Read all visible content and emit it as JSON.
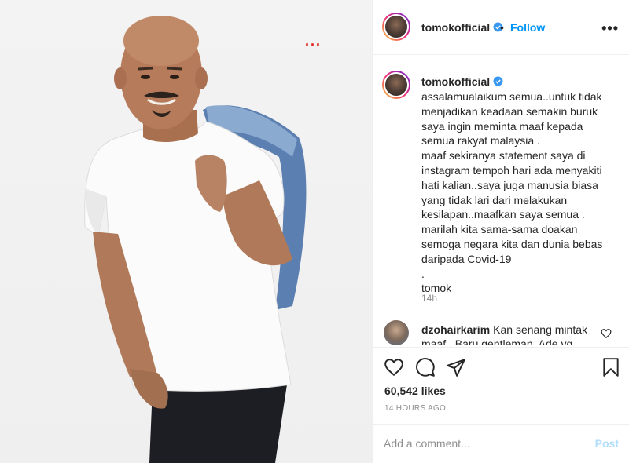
{
  "post": {
    "username": "tomokofficial",
    "follow_label": "Follow",
    "dot": "•",
    "more_label": "•••",
    "caption": "assalamualaikum semua..untuk tidak menjadikan keadaan semakin buruk saya ingin meminta maaf kepada semua rakyat malaysia .\nmaaf sekiranya statement saya di instagram tempoh hari ada menyakiti hati kalian..saya juga manusia biasa yang tidak lari dari melakukan kesilapan..maafkan saya semua .\nmarilah kita sama-sama doakan semoga negara kita dan dunia bebas daripada Covid-19\n.\ntomok",
    "caption_time": "14h",
    "likes": "60,542 likes",
    "posted_time": "14 HOURS AGO"
  },
  "photo": {
    "overlay_dots": "..."
  },
  "comment": {
    "username": "dzohairkarim",
    "text": "Kan senang mintak maaf.. Baru gentleman. Ade yg"
  },
  "add_comment": {
    "placeholder": "Add a comment...",
    "post_label": "Post"
  },
  "colors": {
    "accent": "#0095f6",
    "post_disabled": "#b2dffc",
    "muted": "#8e8e8e",
    "photo_dots": "#e0231b"
  },
  "icons": [
    "verified-badge-icon",
    "more-options-icon",
    "heart-icon",
    "comment-icon",
    "share-icon",
    "bookmark-icon",
    "small-heart-icon"
  ]
}
